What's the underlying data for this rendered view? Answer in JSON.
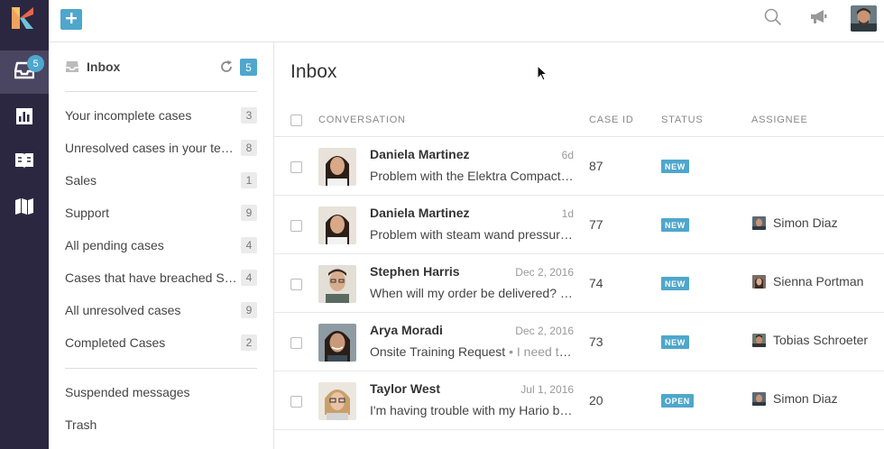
{
  "rail": {
    "inbox_badge": "5",
    "items": [
      {
        "icon": "inbox-icon"
      },
      {
        "icon": "reports-icon"
      },
      {
        "icon": "knowledge-base-icon"
      },
      {
        "icon": "map-icon"
      }
    ]
  },
  "topbar": {
    "add_icon": "plus-icon",
    "search_icon": "search-icon",
    "announce_icon": "megaphone-icon"
  },
  "sidebar": {
    "title": "Inbox",
    "count": "5",
    "views": [
      {
        "label": "Your incomplete cases",
        "count": "3"
      },
      {
        "label": "Unresolved cases in your team",
        "count": "8"
      },
      {
        "label": "Sales",
        "count": "1"
      },
      {
        "label": "Support",
        "count": "9"
      },
      {
        "label": "All pending cases",
        "count": "4"
      },
      {
        "label": "Cases that have breached SLA",
        "count": "4"
      },
      {
        "label": "All unresolved cases",
        "count": "9"
      },
      {
        "label": "Completed Cases",
        "count": "2"
      }
    ],
    "extra": [
      {
        "label": "Suspended messages"
      },
      {
        "label": "Trash"
      }
    ]
  },
  "main": {
    "title": "Inbox",
    "columns": {
      "conversation": "CONVERSATION",
      "case_id": "CASE ID",
      "status": "STATUS",
      "assignee": "ASSIGNEE"
    },
    "rows": [
      {
        "name": "Daniela Martinez",
        "time": "6d",
        "subject": "Problem with the Elektra Compact coffee grinder",
        "preview": "",
        "case_id": "87",
        "status": "NEW",
        "assignee": ""
      },
      {
        "name": "Daniela Martinez",
        "time": "1d",
        "subject": "Problem with steam wand pressure",
        "preview": "•",
        "case_id": "77",
        "status": "NEW",
        "assignee": "Simon Diaz"
      },
      {
        "name": "Stephen Harris",
        "time": "Dec 2, 2016",
        "subject": "When will my order be delivered?",
        "preview": "• ...",
        "case_id": "74",
        "status": "NEW",
        "assignee": "Sienna Portman"
      },
      {
        "name": "Arya Moradi",
        "time": "Dec 2, 2016",
        "subject": "Onsite Training Request",
        "preview": "• I need training for my staff",
        "case_id": "73",
        "status": "NEW",
        "assignee": "Tobias Schroeter"
      },
      {
        "name": "Taylor West",
        "time": "Jul 1, 2016",
        "subject": "I'm having trouble with my Hario burr grinder",
        "preview": "",
        "case_id": "20",
        "status": "OPEN",
        "assignee": "Simon Diaz"
      }
    ]
  },
  "colors": {
    "rail": "#2c2740",
    "accent": "#4ea7cc",
    "border": "#e3e3e3"
  }
}
